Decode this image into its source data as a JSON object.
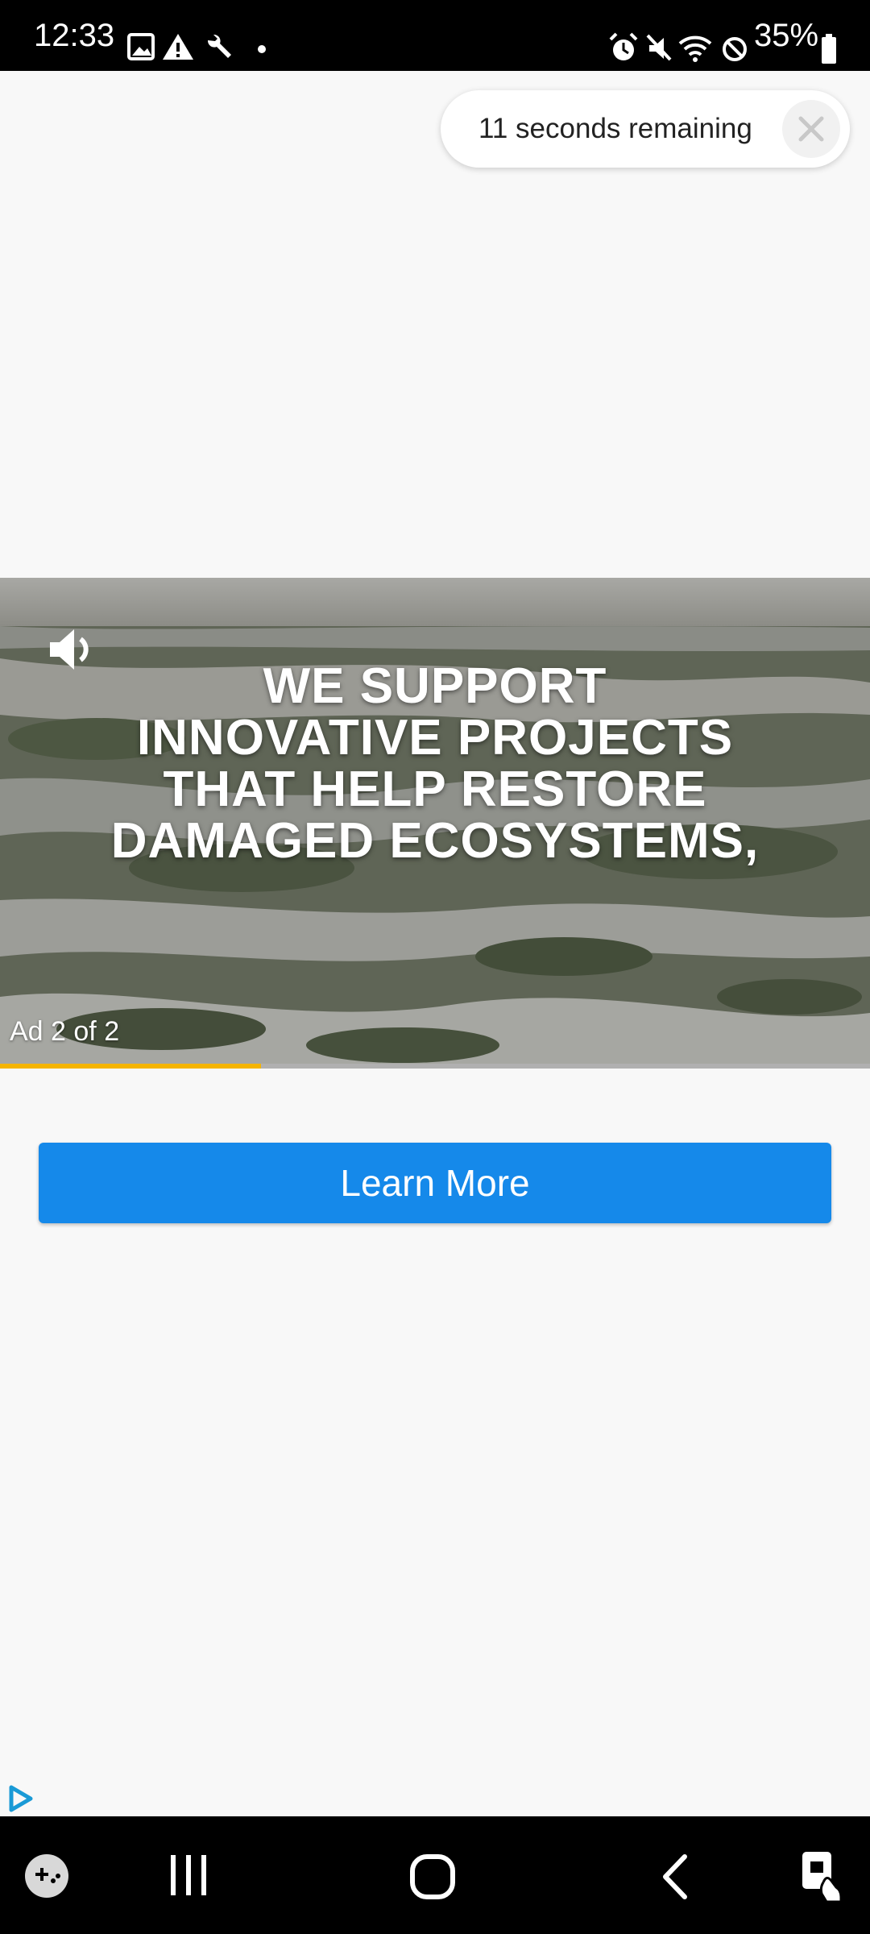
{
  "status_bar": {
    "time": "12:33",
    "battery": "35%",
    "left_icons": [
      "image-icon",
      "warning-icon",
      "wrench-icon",
      "dot-icon"
    ],
    "right_icons": [
      "alarm-icon",
      "mute-icon",
      "wifi-icon",
      "do-not-disturb-icon",
      "battery-icon"
    ]
  },
  "timer": {
    "text": "11 seconds remaining"
  },
  "video": {
    "caption_lines": [
      "WE SUPPORT",
      "INNOVATIVE PROJECTS",
      "THAT HELP RESTORE",
      "DAMAGED ECOSYSTEMS,"
    ],
    "ad_counter": "Ad 2 of 2",
    "progress_fraction": 0.3
  },
  "cta": {
    "label": "Learn More",
    "color": "#1589ea"
  },
  "colors": {
    "progress": "#f4b400",
    "background": "#f8f8f8"
  },
  "nav_bar": {
    "icons": [
      "game-launcher-icon",
      "recent-apps-icon",
      "home-icon",
      "back-icon",
      "assistant-touch-icon"
    ]
  }
}
